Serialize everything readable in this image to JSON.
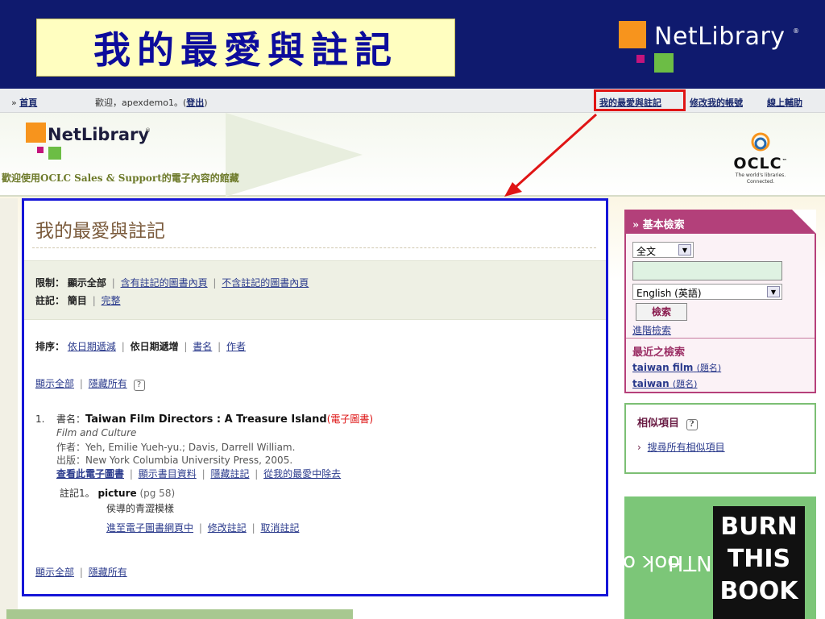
{
  "slide": {
    "title": "我的最愛與註記",
    "logo_text": "NetLibrary",
    "logo_reg": "®"
  },
  "topbar": {
    "breadcrumb_prefix": "»",
    "home_link": "首頁",
    "welcome": "歡迎，apexdemo1。(",
    "logout_link": "登出",
    "welcome_close": ")",
    "favorites_link": "我的最愛與註記",
    "account_link": "修改我的帳號",
    "help_link": "線上輔助"
  },
  "banner": {
    "logo_text": "NetLibrary",
    "logo_reg": "®",
    "welcome_message": "歡迎使用OCLC Sales & Support的電子內容的館藏",
    "oclc_name": "OCLC",
    "oclc_tm": "™",
    "oclc_tagline_1": "The world's libraries.",
    "oclc_tagline_2": "Connected."
  },
  "main": {
    "title": "我的最愛與註記",
    "limit": {
      "label": "限制：",
      "current": "顯示全部",
      "options": [
        "含有註記的圖書內頁",
        "不含註記的圖書內頁"
      ]
    },
    "notes": {
      "label": "註記：",
      "current": "簡目",
      "options": [
        "完整"
      ]
    },
    "sort": {
      "label": "排序：",
      "option_1": "依日期遞減",
      "current": "依日期遞增",
      "option_3": "書名",
      "option_4": "作者"
    },
    "show_all": "顯示全部",
    "hide_all": "隱藏所有",
    "help_glyph": "?",
    "record": {
      "number": "1.",
      "title_label": "書名：",
      "title": "Taiwan Film Directors : A Treasure Island",
      "ebook_tag": "(電子圖書)",
      "series": "Film and Culture",
      "author": "作者：Yeh, Emilie Yueh-yu.; Davis, Darrell William.",
      "publisher": "出版：New York Columbia University Press, 2005.",
      "actions": [
        "查看此電子圖書",
        "顯示書目資料",
        "隱藏註記",
        "從我的最愛中除去"
      ],
      "note_label": "註記1。",
      "note_keyword": "picture",
      "note_page": "(pg 58)",
      "note_text": "侯導的青澀模樣",
      "note_actions": [
        "進至電子圖書網頁中",
        "修改註記",
        "取消註記"
      ]
    }
  },
  "sidebar": {
    "search": {
      "header": "基本檢索",
      "header_icon": "»",
      "scope_value": "全文",
      "input_value": "",
      "language_value": "English (英語)",
      "button": "檢索",
      "advanced_link": "進階檢索",
      "recent_title": "最近之檢索",
      "recent": [
        {
          "term": "taiwan film",
          "tag": "(題名)"
        },
        {
          "term": "taiwan",
          "tag": "(題名)"
        }
      ]
    },
    "similar": {
      "title": "相似項目",
      "link": "搜尋所有相似項目",
      "bullet": "›"
    },
    "botm": {
      "vertical_line_1": "ook of the",
      "vertical_line_2": "ONTH",
      "book_line_1": "BURN",
      "book_line_2": "THIS",
      "book_line_3": "BOOK"
    }
  },
  "colors": {
    "slide_bg": "#0f1a6e",
    "title_bg": "#fffec0",
    "title_text": "#0c0c9c",
    "highlight_red": "#e01515",
    "panel_blue": "#1616d8",
    "link_blue": "#2a3a8c",
    "search_magenta": "#b3407a",
    "similar_green": "#7cbf74"
  },
  "icons": {
    "help": "help-icon",
    "dropdown": "chevron-down-icon",
    "annotation": "red-arrow"
  }
}
